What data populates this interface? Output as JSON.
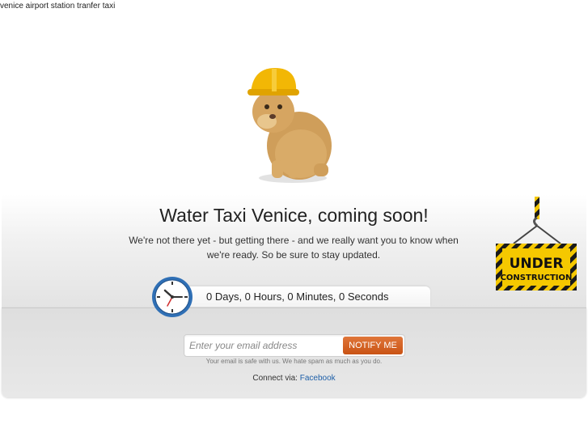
{
  "site": {
    "title": "venice airport station tranfer taxi"
  },
  "hero": {
    "headline": "Water Taxi Venice, coming soon!",
    "subtext": "We're not there yet - but getting there - and we really want you to know when we're ready. So be sure to stay updated."
  },
  "countdown": {
    "text": "0 Days, 0 Hours, 0 Minutes, 0 Seconds"
  },
  "sign": {
    "line1": "UNDER",
    "line2": "CONSTRUCTION"
  },
  "signup": {
    "placeholder": "Enter your email address",
    "button_label": "NOTIFY ME",
    "note": "Your email is safe with us. We hate spam as much as you do."
  },
  "connect": {
    "label": "Connect via:",
    "link_text": "Facebook"
  },
  "colors": {
    "accent": "#c95314",
    "link": "#1d5fa8",
    "helmet": "#f2b705"
  }
}
